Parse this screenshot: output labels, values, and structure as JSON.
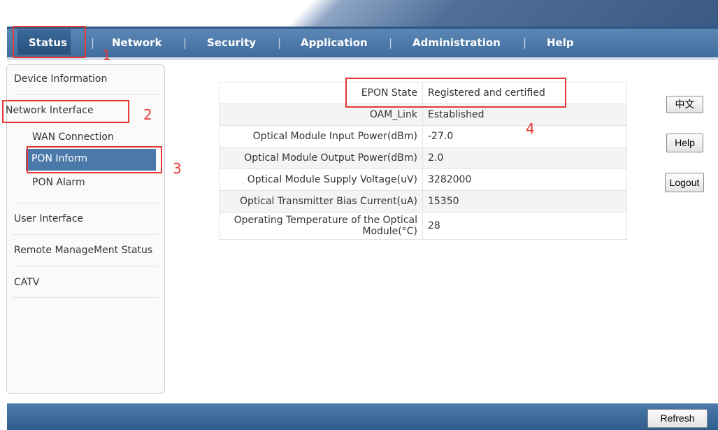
{
  "nav": {
    "items": [
      "Status",
      "Network",
      "Security",
      "Application",
      "Administration",
      "Help"
    ],
    "separator": "|"
  },
  "annotations": [
    "1",
    "2",
    "3",
    "4"
  ],
  "sidebar": {
    "items": {
      "device_info": "Device Information",
      "network_interface": "Network Interface",
      "user_interface": "User Interface",
      "remote_mgmt": "Remote ManageMent Status",
      "catv": "CATV"
    },
    "sub_items": [
      "WAN Connection",
      "PON Inform",
      "PON Alarm"
    ]
  },
  "pon_table": {
    "rows": [
      {
        "label": "EPON State",
        "value": "Registered and certified"
      },
      {
        "label": "OAM_Link",
        "value": "Established"
      },
      {
        "label": "Optical Module Input Power(dBm)",
        "value": "-27.0"
      },
      {
        "label": "Optical Module Output Power(dBm)",
        "value": "2.0"
      },
      {
        "label": "Optical Module Supply Voltage(uV)",
        "value": "3282000"
      },
      {
        "label": "Optical Transmitter Bias Current(uA)",
        "value": "15350"
      },
      {
        "label": "Operating Temperature of the Optical Module(°C)",
        "value": "28"
      }
    ]
  },
  "buttons": {
    "language": "中文",
    "help": "Help",
    "logout": "Logout",
    "refresh": "Refresh"
  },
  "colors": {
    "nav_bg": "#4a78a8",
    "active_bg": "#2d5a88",
    "annotation_red": "#e53935"
  }
}
